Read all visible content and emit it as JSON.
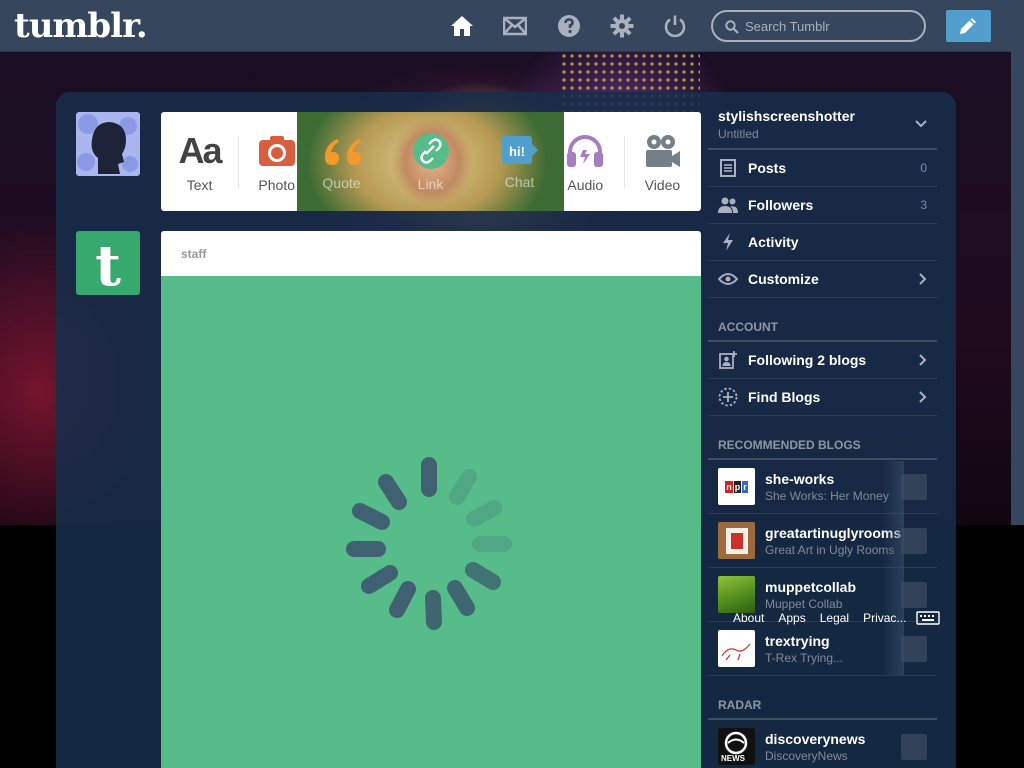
{
  "header": {
    "logo": "tumblr.",
    "search_placeholder": "Search Tumblr"
  },
  "post_types": [
    {
      "label": "Text"
    },
    {
      "label": "Photo"
    },
    {
      "label": "Quote"
    },
    {
      "label": "Link"
    },
    {
      "label": "Chat"
    },
    {
      "label": "Audio"
    },
    {
      "label": "Video"
    }
  ],
  "chat_icon_text": "hi!",
  "text_icon_text": "Aa",
  "post": {
    "author": "staff"
  },
  "sidebar": {
    "blog_name": "stylishscreenshotter",
    "blog_sub": "Untitled",
    "items": [
      {
        "label": "Posts",
        "count": "0"
      },
      {
        "label": "Followers",
        "count": "3"
      },
      {
        "label": "Activity"
      },
      {
        "label": "Customize"
      }
    ],
    "account_heading": "ACCOUNT",
    "account_items": [
      {
        "label": "Following 2 blogs"
      },
      {
        "label": "Find Blogs"
      }
    ],
    "recommended_heading": "RECOMMENDED BLOGS",
    "recommended": [
      {
        "name": "she-works",
        "sub": "She Works: Her Money",
        "thumb_text": "npr"
      },
      {
        "name": "greatartinuglyrooms",
        "sub": "Great Art in Ugly Rooms"
      },
      {
        "name": "muppetcollab",
        "sub": "Muppet Collab"
      },
      {
        "name": "trextrying",
        "sub": "T-Rex Trying..."
      }
    ],
    "radar_heading": "RADAR",
    "radar": [
      {
        "name": "discoverynews",
        "sub": "DiscoveryNews",
        "thumb_text": "NEWS"
      }
    ]
  },
  "footer_links": [
    "About",
    "Apps",
    "Legal",
    "Privac..."
  ]
}
